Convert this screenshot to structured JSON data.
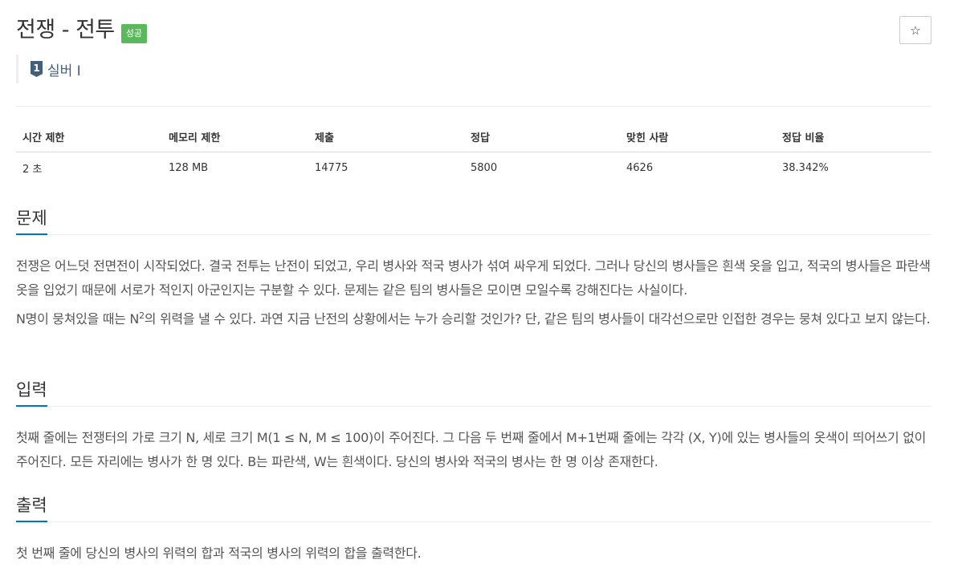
{
  "problem": {
    "title": "전쟁 - 전투",
    "status_badge": "성공",
    "star_icon": "☆",
    "tier": {
      "level": "1",
      "label": "실버 I",
      "icon": "tier-badge-icon",
      "color": "#435f7a"
    }
  },
  "info_table": {
    "headers": [
      "시간 제한",
      "메모리 제한",
      "제출",
      "정답",
      "맞힌 사람",
      "정답 비율"
    ],
    "values": [
      "2 초",
      "128 MB",
      "14775",
      "5800",
      "4626",
      "38.342%"
    ]
  },
  "sections": {
    "description": {
      "title": "문제",
      "p1": "전쟁은 어느덧 전면전이 시작되었다. 결국 전투는 난전이 되었고, 우리 병사와 적국 병사가 섞여 싸우게 되었다. 그러나 당신의 병사들은 흰색 옷을 입고, 적국의 병사들은 파란색 옷을 입었기 때문에 서로가 적인지 아군인지는 구분할 수 있다. 문제는 같은 팀의 병사들은 모이면 모일수록 강해진다는 사실이다.",
      "p2_before": "N명이 뭉쳐있을 때는 N",
      "p2_sup": "2",
      "p2_after": "의 위력을 낼 수 있다. 과연 지금 난전의 상황에서는 누가 승리할 것인가? 단, 같은 팀의 병사들이 대각선으로만 인접한 경우는 뭉쳐 있다고 보지 않는다."
    },
    "input": {
      "title": "입력",
      "p1": "첫째 줄에는 전쟁터의 가로 크기 N, 세로 크기 M(1 ≤ N, M ≤ 100)이 주어진다. 그 다음 두 번째 줄에서 M+1번째 줄에는 각각 (X, Y)에 있는 병사들의 옷색이 띄어쓰기 없이 주어진다. 모든 자리에는 병사가 한 명 있다. B는 파란색, W는 흰색이다. 당신의 병사와 적국의 병사는 한 명 이상 존재한다."
    },
    "output": {
      "title": "출력",
      "p1": "첫 번째 줄에 당신의 병사의 위력의 합과 적국의 병사의 위력의 합을 출력한다."
    }
  },
  "colors": {
    "badge": "#5cb85c",
    "accent": "#0076c0",
    "text": "#555555"
  }
}
